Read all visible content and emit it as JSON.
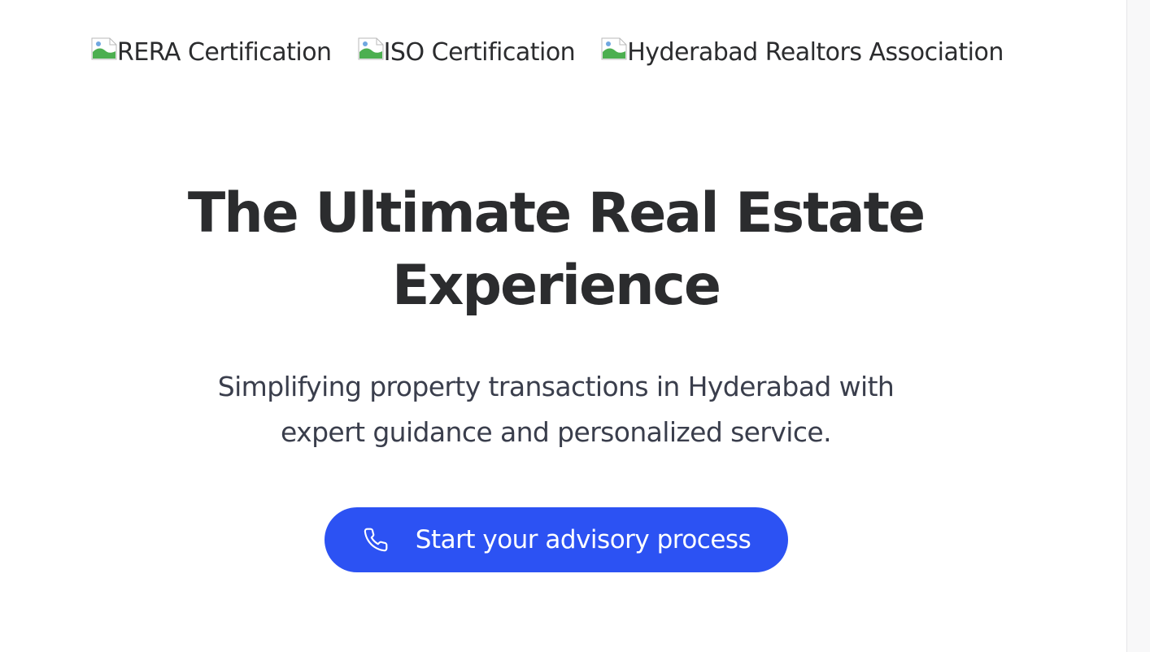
{
  "certifications": [
    {
      "alt": "RERA Certification",
      "icon": "broken-image-icon"
    },
    {
      "alt": "ISO Certification",
      "icon": "broken-image-icon"
    },
    {
      "alt": "Hyderabad Realtors Association",
      "icon": "broken-image-icon"
    }
  ],
  "hero": {
    "title_line1": "The Ultimate Real Estate",
    "title_line2": "Experience",
    "subtitle_line1": "Simplifying property transactions in Hyderabad with",
    "subtitle_line2": "expert guidance and personalized service."
  },
  "cta": {
    "label": "Start your advisory process",
    "icon": "phone-icon"
  },
  "colors": {
    "accent": "#2c52f3",
    "text": "#2b2c2e",
    "subtext": "#3a3e4c",
    "background": "#ffffff"
  }
}
